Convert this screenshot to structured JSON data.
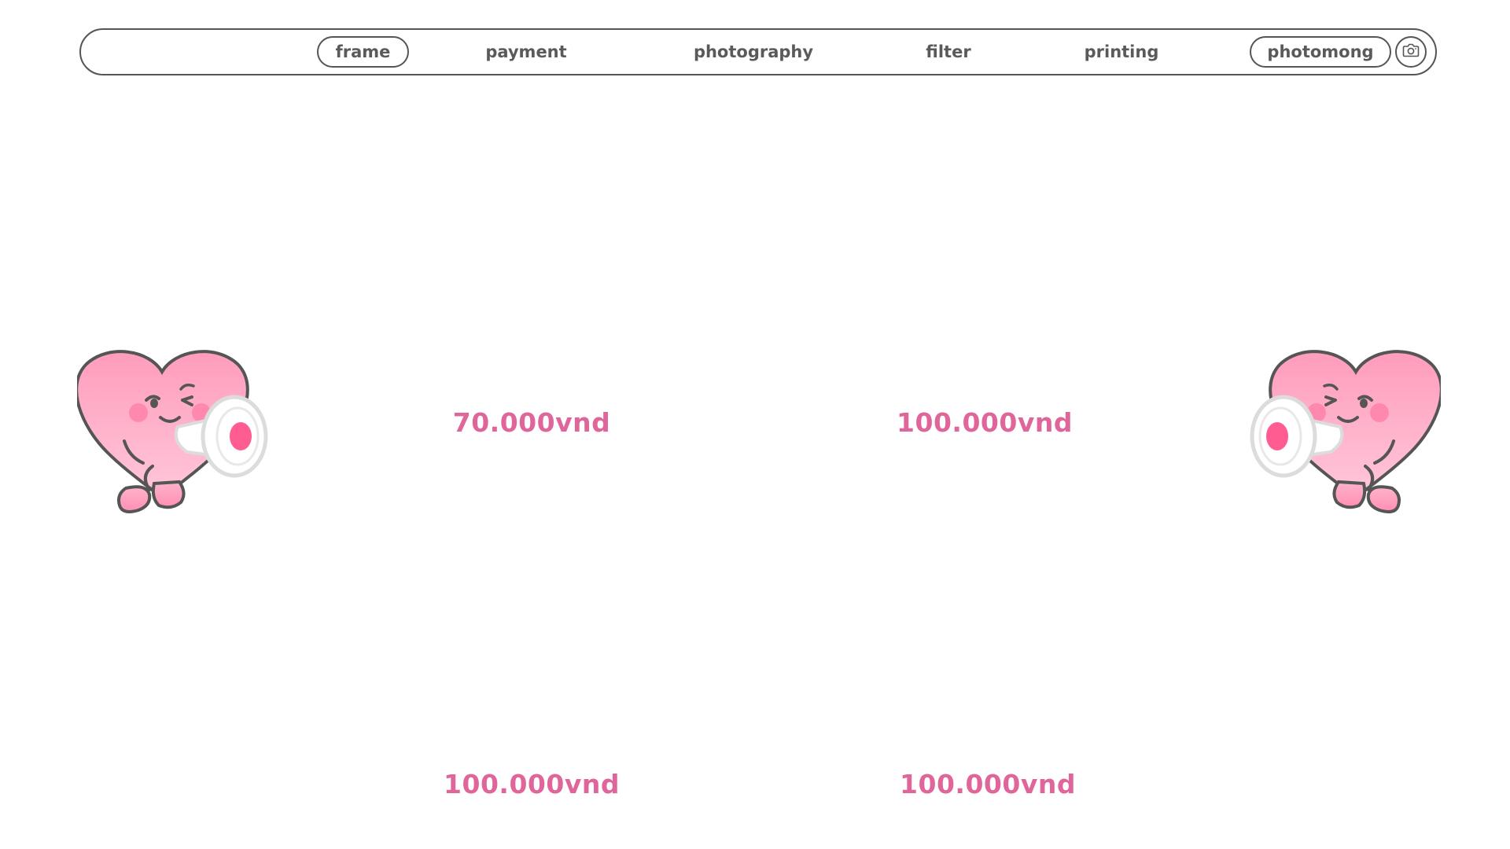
{
  "nav": {
    "items": [
      {
        "label": "frame",
        "active": true
      },
      {
        "label": "payment",
        "active": false
      },
      {
        "label": "photography",
        "active": false
      },
      {
        "label": "filter",
        "active": false
      },
      {
        "label": "printing",
        "active": false
      }
    ],
    "brand_label": "photomong",
    "camera_icon": "camera-icon"
  },
  "prices": [
    {
      "label": "70.000vnd"
    },
    {
      "label": "100.000vnd"
    },
    {
      "label": "100.000vnd"
    },
    {
      "label": "100.000vnd"
    }
  ],
  "mascots": [
    {
      "icon": "heart-mascot-megaphone-icon",
      "facing": "right"
    },
    {
      "icon": "heart-mascot-megaphone-icon",
      "facing": "left"
    }
  ],
  "colors": {
    "accent_pink": "#e0659a",
    "heart_pink": "#ff9cbc",
    "outline": "#555555",
    "nav_text": "#5a5a5a"
  }
}
